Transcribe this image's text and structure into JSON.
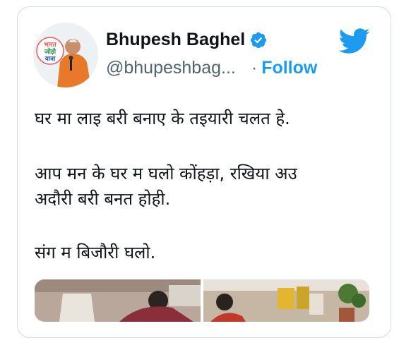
{
  "tweet": {
    "author": {
      "name": "Bhupesh Baghel",
      "handle": "@bhupeshbag...",
      "verified": true,
      "avatar_badge_text": [
        "भारत",
        "जोड़ो",
        "यात्रा"
      ]
    },
    "separator": "·",
    "follow_label": "Follow",
    "text_lines": [
      "घर मा लाइ बरी बनाए के तइयारी  चलत हे.",
      "आप मन के घर म घलो  कोंहड़ा, रखिया अउ",
      "अदौरी बरी बनत होही.",
      "संग म बिजौरी घलो."
    ],
    "media_count": 2
  },
  "colors": {
    "brand_blue": "#1d9bf0",
    "text_primary": "#0f1419",
    "text_secondary": "#536471",
    "border": "#d4dbe0"
  },
  "icons": [
    "verified-badge-icon",
    "twitter-bird-icon"
  ]
}
